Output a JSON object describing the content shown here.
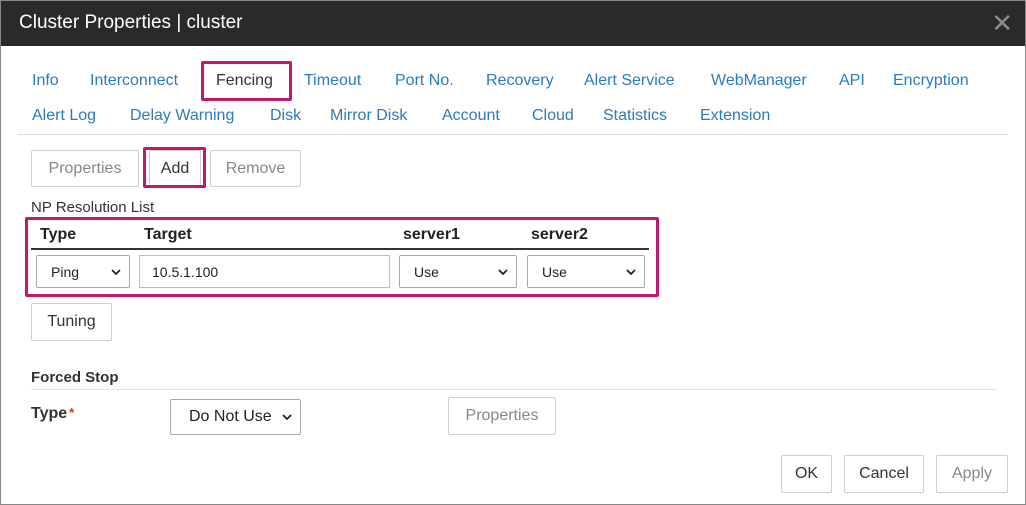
{
  "window": {
    "title": "Cluster Properties | cluster",
    "close_symbol": "✕"
  },
  "tabs": {
    "row1": [
      "Info",
      "Interconnect",
      "Fencing",
      "Timeout",
      "Port No.",
      "Recovery",
      "Alert Service",
      "WebManager",
      "API",
      "Encryption"
    ],
    "row2": [
      "Alert Log",
      "Delay Warning",
      "Disk",
      "Mirror Disk",
      "Account",
      "Cloud",
      "Statistics",
      "Extension"
    ],
    "active": "Fencing"
  },
  "np_toolbar": {
    "properties": "Properties",
    "add": "Add",
    "remove": "Remove"
  },
  "np_list": {
    "title": "NP Resolution List",
    "columns": [
      "Type",
      "Target",
      "server1",
      "server2"
    ],
    "rows": [
      {
        "type": "Ping",
        "target": "10.5.1.100",
        "server1": "Use",
        "server2": "Use"
      }
    ]
  },
  "tuning_label": "Tuning",
  "forced_stop": {
    "section_title": "Forced Stop",
    "type_label": "Type",
    "required_mark": "*",
    "type_value": "Do Not Use",
    "properties": "Properties"
  },
  "footer": {
    "ok": "OK",
    "cancel": "Cancel",
    "apply": "Apply"
  },
  "colors": {
    "highlight": "#c0186a",
    "link": "#2a7bc0",
    "titlebar": "#2a2a2a"
  }
}
